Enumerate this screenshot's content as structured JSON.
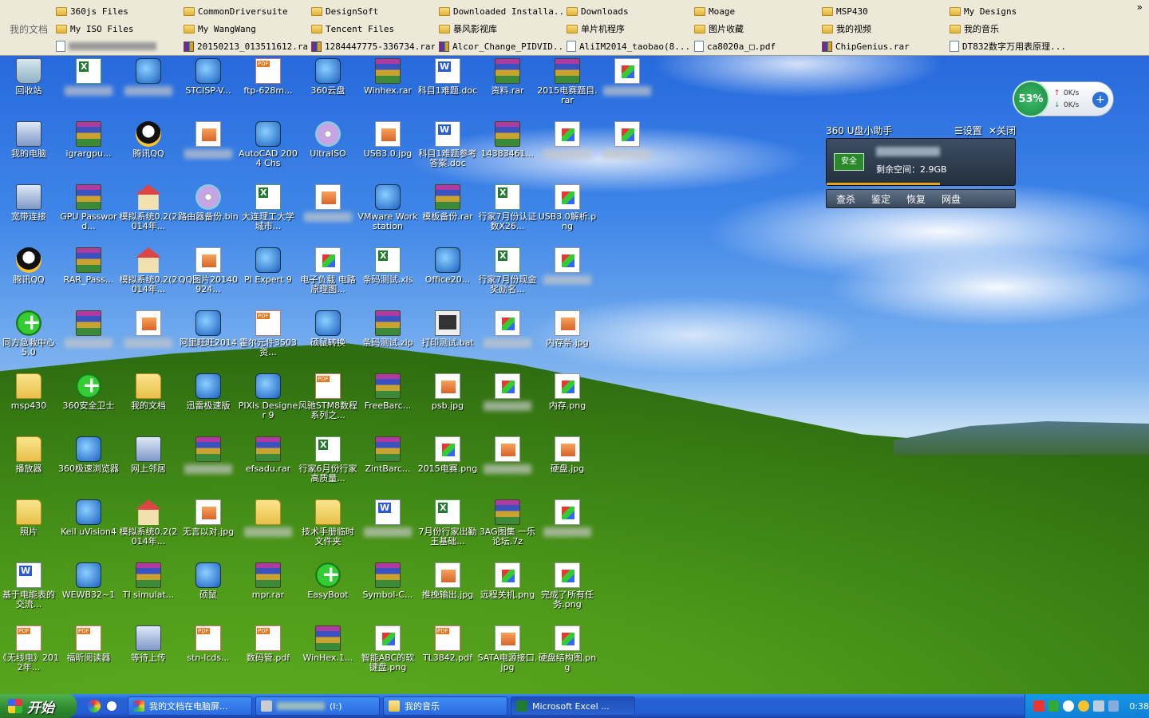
{
  "topbar": {
    "label": "我的文档",
    "rows": [
      [
        {
          "k": "folder",
          "t": "360js Files"
        },
        {
          "k": "folder",
          "t": "CommonDriversuite"
        },
        {
          "k": "folder",
          "t": "DesignSoft"
        },
        {
          "k": "folder",
          "t": "Downloaded Installa..."
        },
        {
          "k": "folder",
          "t": "Downloads"
        },
        {
          "k": "folder",
          "t": "Moage"
        },
        {
          "k": "folder",
          "t": "MSP430"
        },
        {
          "k": "folder",
          "t": "My Designs"
        }
      ],
      [
        {
          "k": "folder",
          "t": "My ISO Files"
        },
        {
          "k": "folder",
          "t": "My WangWang"
        },
        {
          "k": "folder",
          "t": "Tencent Files"
        },
        {
          "k": "folder",
          "t": "暴风影视库"
        },
        {
          "k": "folder",
          "t": "单片机程序"
        },
        {
          "k": "folder",
          "t": "图片收藏"
        },
        {
          "k": "folder",
          "t": "我的视频"
        },
        {
          "k": "folder",
          "t": "我的音乐"
        }
      ],
      [
        {
          "k": "doc",
          "t": ""
        },
        {
          "k": "rar",
          "t": "20150213_013511612.rar"
        },
        {
          "k": "rar",
          "t": "1284447775-336734.rar"
        },
        {
          "k": "rar",
          "t": "Alcor_Change_PIDVID..."
        },
        {
          "k": "doc",
          "t": "AliIM2014_taobao(8...."
        },
        {
          "k": "doc",
          "t": "ca8020a_□.pdf"
        },
        {
          "k": "rar",
          "t": "ChipGenius.rar"
        },
        {
          "k": "doc",
          "t": "DT832数字万用表原理..."
        }
      ]
    ],
    "close": "»"
  },
  "icons": [
    [
      "回收站",
      "bin"
    ],
    [
      "",
      "xls",
      1
    ],
    [
      "",
      "app",
      1
    ],
    [
      "STCISP-V...",
      "app"
    ],
    [
      "ftp-628m...",
      "pdf"
    ],
    [
      "360云盘",
      "app"
    ],
    [
      "Winhex.rar",
      "rar"
    ],
    [
      "科目1难题.doc",
      "doc"
    ],
    [
      "资料.rar",
      "rar"
    ],
    [
      "2015电赛题目.rar",
      "rar"
    ],
    [
      "",
      "img",
      1
    ],
    [
      "我的电脑",
      "pc"
    ],
    [
      "igrargpu...",
      "rar"
    ],
    [
      "腾讯QQ",
      "qq"
    ],
    [
      "",
      "jpg",
      1
    ],
    [
      "AutoCAD 2004 Chs",
      "app"
    ],
    [
      "UltraISO",
      "cd"
    ],
    [
      "USB3.0.jpg",
      "jpg"
    ],
    [
      "科目1难题参考答案.doc",
      "doc"
    ],
    [
      "14383461...",
      "rar"
    ],
    [
      "",
      "img",
      1
    ],
    [
      "",
      "img",
      1
    ],
    [
      "宽带连接",
      "pc"
    ],
    [
      "GPU Password...",
      "rar"
    ],
    [
      "模拟系统0.2(2014年...",
      "house"
    ],
    [
      "路由器备份.bin",
      "cd"
    ],
    [
      "大连理工大学城市...",
      "xls"
    ],
    [
      "",
      "jpg",
      1
    ],
    [
      "VMware Workstation",
      "app"
    ],
    [
      "模板备份.rar",
      "rar"
    ],
    [
      "行家7月份认证数X26...",
      "xls"
    ],
    [
      "USB3.0解析.png",
      "img"
    ],
    [
      "腾讯QQ",
      "qq"
    ],
    [
      "RAR_Pass...",
      "rar"
    ],
    [
      "模拟系统0.2(2014年...",
      "house"
    ],
    [
      "QQ图片20140924...",
      "jpg"
    ],
    [
      "PI Expert 9",
      "app"
    ],
    [
      "电子负载 电路原理图...",
      "img"
    ],
    [
      "条码测试.xls",
      "xls"
    ],
    [
      "Office20...",
      "app"
    ],
    [
      "行家7月份现金奖励名...",
      "xls"
    ],
    [
      "",
      "img",
      1
    ],
    [
      "同方急救中心5.0",
      "green"
    ],
    [
      "",
      "rar",
      1
    ],
    [
      "",
      "jpg",
      1
    ],
    [
      "阿里旺旺2014",
      "app"
    ],
    [
      "霍尔元件3503资...",
      "pdf"
    ],
    [
      "硕鼠转换",
      "app"
    ],
    [
      "条码测试.zip",
      "rar"
    ],
    [
      "打印测试.bat",
      "bat"
    ],
    [
      "",
      "img",
      1
    ],
    [
      "内存条.jpg",
      "jpg"
    ],
    [
      "msp430",
      "folder"
    ],
    [
      "360安全卫士",
      "green"
    ],
    [
      "我的文档",
      "folder"
    ],
    [
      "迅雷极速版",
      "app"
    ],
    [
      "PIXls Designer 9",
      "app"
    ],
    [
      "风驰STM8数程系列之...",
      "pdf"
    ],
    [
      "FreeBarc...",
      "rar"
    ],
    [
      "psb.jpg",
      "jpg"
    ],
    [
      "",
      "img",
      1
    ],
    [
      "内存.png",
      "img"
    ],
    [
      "播放器",
      "folder"
    ],
    [
      "360极速浏览器",
      "app"
    ],
    [
      "网上邻居",
      "pc"
    ],
    [
      "",
      "rar",
      1
    ],
    [
      "efsadu.rar",
      "rar"
    ],
    [
      "行家6月份行家高质量...",
      "xls"
    ],
    [
      "ZintBarc...",
      "rar"
    ],
    [
      "2015电赛.png",
      "img"
    ],
    [
      "",
      "jpg",
      1
    ],
    [
      "硬盘.jpg",
      "jpg"
    ],
    [
      "照片",
      "folder"
    ],
    [
      "Keil uVision4",
      "app"
    ],
    [
      "模拟系统0.2(2014年...",
      "house"
    ],
    [
      "无言以对.jpg",
      "jpg"
    ],
    [
      "",
      "folder",
      1
    ],
    [
      "技术手册临时文件夹",
      "folder"
    ],
    [
      "",
      "doc",
      1
    ],
    [
      "7月份行家出勤王基础...",
      "xls"
    ],
    [
      "3AG图集 一乐论坛.7z",
      "rar"
    ],
    [
      "",
      "img",
      1
    ],
    [
      "基于电能表的交流...",
      "doc"
    ],
    [
      "WEWB32~1",
      "app"
    ],
    [
      "TI simulat...",
      "rar"
    ],
    [
      "硕鼠",
      "app"
    ],
    [
      "mpr.rar",
      "rar"
    ],
    [
      "EasyBoot",
      "green"
    ],
    [
      "Symbol-C...",
      "rar"
    ],
    [
      "推挽输出.jpg",
      "jpg"
    ],
    [
      "远程关机.png",
      "img"
    ],
    [
      "完成了所有任务.png",
      "img"
    ],
    [
      "《无线电》2012年...",
      "pdf"
    ],
    [
      "福昕阅读器",
      "pdf"
    ],
    [
      "等待上传",
      "pc"
    ],
    [
      "stn-lcds...",
      "pdf"
    ],
    [
      "数码管.pdf",
      "pdf"
    ],
    [
      "WinHex.1...",
      "rar"
    ],
    [
      "智能ABC的软键盘.png",
      "img"
    ],
    [
      "TL3842.pdf",
      "pdf"
    ],
    [
      "SATA电源接口.jpg",
      "jpg"
    ],
    [
      "硬盘结构图.png",
      "img"
    ]
  ],
  "netwidget": {
    "percent": "53%",
    "up": "0K/s",
    "down": "0K/s",
    "up_arrow": "↑",
    "down_arrow": "↓",
    "plus": "+"
  },
  "usb": {
    "title": "360 U盘小助手",
    "settings": "☰设置",
    "close": "✕关闭",
    "badge": "安全",
    "free": "剩余空间：2.9GB",
    "actions": [
      "查杀",
      "鉴定",
      "恢复",
      "网盘"
    ]
  },
  "taskbar": {
    "start": "开始",
    "buttons": [
      "我的文档在电脑屏...",
      "(I:)",
      "我的音乐",
      "Microsoft Excel ..."
    ],
    "clock": "0:38"
  }
}
